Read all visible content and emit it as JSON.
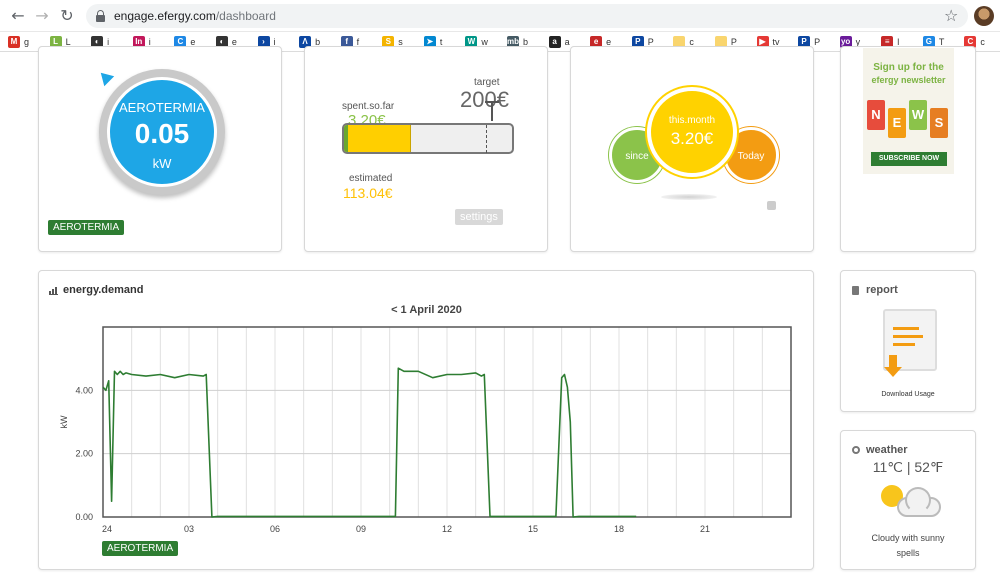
{
  "browser": {
    "url_host": "engage.efergy.com",
    "url_path": "/dashboard",
    "bookmarks": [
      {
        "letter": "g",
        "color": "#d93025",
        "glyph": "M"
      },
      {
        "letter": "L",
        "color": "#7cb342",
        "glyph": "L"
      },
      {
        "letter": "i",
        "color": "#333333",
        "glyph": "◐"
      },
      {
        "letter": "i",
        "color": "#c2185b",
        "glyph": "In"
      },
      {
        "letter": "e",
        "color": "#1e88e5",
        "glyph": "C"
      },
      {
        "letter": "e",
        "color": "#333333",
        "glyph": "◐"
      },
      {
        "letter": "i",
        "color": "#0d47a1",
        "glyph": "›"
      },
      {
        "letter": "b",
        "color": "#0d47a1",
        "glyph": "Λ"
      },
      {
        "letter": "f",
        "color": "#3b5998",
        "glyph": "f"
      },
      {
        "letter": "s",
        "color": "#f4b400",
        "glyph": "S"
      },
      {
        "letter": "t",
        "color": "#0288d1",
        "glyph": "➤"
      },
      {
        "letter": "w",
        "color": "#009688",
        "glyph": "W"
      },
      {
        "letter": "b",
        "color": "#455a64",
        "glyph": "mb"
      },
      {
        "letter": "a",
        "color": "#222222",
        "glyph": "a"
      },
      {
        "letter": "e",
        "color": "#c62828",
        "glyph": "e"
      },
      {
        "letter": "P",
        "color": "#0d47a1",
        "glyph": "P"
      },
      {
        "letter": "c",
        "color": "#f9d56e",
        "glyph": ""
      },
      {
        "letter": "P",
        "color": "#f9d56e",
        "glyph": ""
      },
      {
        "letter": "tv",
        "color": "#e53935",
        "glyph": "▶"
      },
      {
        "letter": "P",
        "color": "#0d47a1",
        "glyph": "P"
      },
      {
        "letter": "y",
        "color": "#6a1b9a",
        "glyph": "yo"
      },
      {
        "letter": "l",
        "color": "#c62828",
        "glyph": "≡"
      },
      {
        "letter": "T",
        "color": "#1e88e5",
        "glyph": "G"
      },
      {
        "letter": "c",
        "color": "#e53935",
        "glyph": "C"
      }
    ]
  },
  "power_card": {
    "gauge_label": "AEROTERMIA",
    "gauge_value": "0.05",
    "gauge_unit": "kW",
    "tag": "AEROTERMIA"
  },
  "budget_card": {
    "spent_label": "spent.so.far",
    "spent_value": "3.20€",
    "target_label": "target",
    "target_value": "200€",
    "estimated_label": "estimated",
    "estimated_value": "113.04€",
    "progress_fraction": 0.4,
    "settings_label": "settings"
  },
  "cost_card": {
    "since_label": "since",
    "month_label": "this.month",
    "month_value": "3.20€",
    "today_label": "Today"
  },
  "newsletter_ad": {
    "headline_line1": "Sign up for the",
    "headline_line2": "efergy newsletter",
    "tag_letters": [
      "N",
      "E",
      "W",
      "S"
    ],
    "button": "SUBSCRIBE NOW"
  },
  "energy_card": {
    "title": "energy.demand",
    "date_nav": "<  1 April 2020",
    "tag": "AEROTERMIA"
  },
  "report_card": {
    "title": "report",
    "caption": "Download Usage"
  },
  "weather_card": {
    "title": "weather",
    "temp": "11℃ | 52℉",
    "description": "Cloudy with sunny spells"
  },
  "chart_data": {
    "type": "line",
    "ylabel": "kW",
    "ylim": [
      0,
      6
    ],
    "y_ticks": [
      "0.00",
      "2.00",
      "4.00"
    ],
    "x_ticks": [
      "24",
      "03",
      "06",
      "09",
      "12",
      "15",
      "18",
      "21"
    ],
    "xlim_hours": [
      0,
      24
    ],
    "color": "#2e7d32",
    "series": [
      {
        "x": [
          0.0,
          0.1,
          0.2,
          0.3,
          0.4,
          0.5,
          0.6,
          0.7,
          0.8,
          1.0,
          1.5,
          2.0,
          2.5,
          3.0,
          3.5,
          3.6,
          3.8,
          4.0,
          5.0,
          8.0,
          10.0,
          10.2,
          10.3,
          10.5,
          11.0,
          11.5,
          12.0,
          12.5,
          13.0,
          13.2,
          13.3,
          13.5,
          14.0,
          15.0,
          15.8,
          16.0,
          16.1,
          16.2,
          16.3,
          16.4,
          16.6,
          16.8,
          17.0,
          18.0,
          18.6
        ],
        "y": [
          4.1,
          4.0,
          4.3,
          0.5,
          4.6,
          4.5,
          4.6,
          4.5,
          4.55,
          4.5,
          4.45,
          4.5,
          4.4,
          4.5,
          4.45,
          4.5,
          0.0,
          0.02,
          0.02,
          0.02,
          0.02,
          0.02,
          4.7,
          4.6,
          4.6,
          4.4,
          4.5,
          4.5,
          4.55,
          4.45,
          4.5,
          0.02,
          0.02,
          0.02,
          0.02,
          4.4,
          4.5,
          4.1,
          3.0,
          0.0,
          0.02,
          0.02,
          0.02,
          0.02,
          0.02
        ]
      }
    ]
  }
}
